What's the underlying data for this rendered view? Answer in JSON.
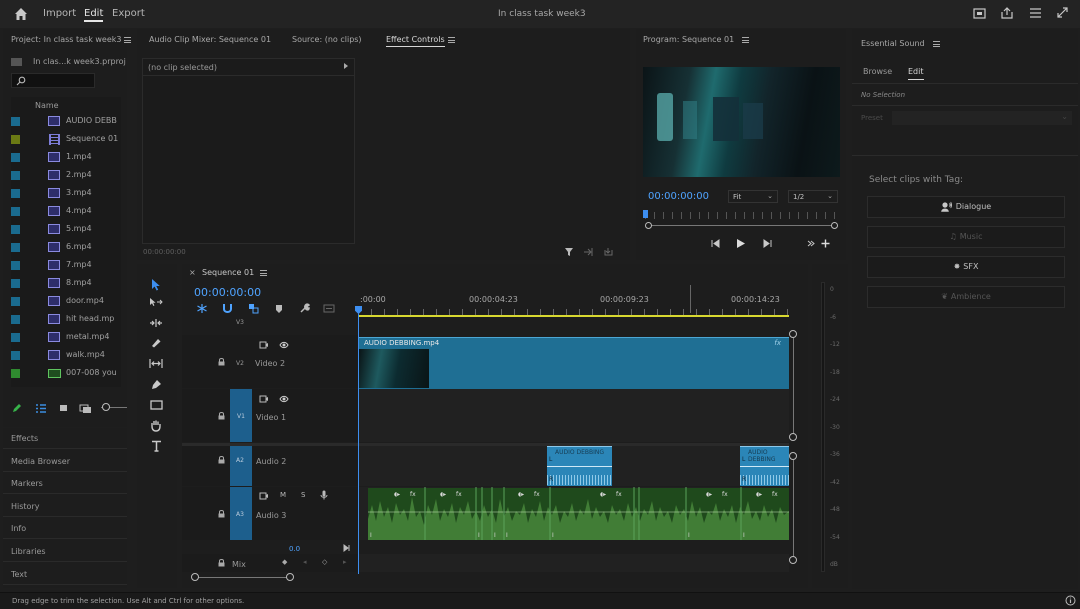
{
  "topbar": {
    "nav": [
      "Import",
      "Edit",
      "Export"
    ],
    "active": "Edit",
    "title": "In class task week3"
  },
  "project": {
    "header": "Project: In class task week3",
    "file": "In clas...k week3.prproj",
    "col_name": "Name",
    "items": [
      {
        "name": "AUDIO DEBB",
        "color": "#1a6b8f",
        "kind": "video"
      },
      {
        "name": "Sequence 01",
        "color": "#6b7a14",
        "kind": "sequence"
      },
      {
        "name": "1.mp4",
        "color": "#1a6b8f",
        "kind": "video"
      },
      {
        "name": "2.mp4",
        "color": "#1a6b8f",
        "kind": "video"
      },
      {
        "name": "3.mp4",
        "color": "#1a6b8f",
        "kind": "video"
      },
      {
        "name": "4.mp4",
        "color": "#1a6b8f",
        "kind": "video"
      },
      {
        "name": "5.mp4",
        "color": "#1a6b8f",
        "kind": "video"
      },
      {
        "name": "6.mp4",
        "color": "#1a6b8f",
        "kind": "video"
      },
      {
        "name": "7.mp4",
        "color": "#1a6b8f",
        "kind": "video"
      },
      {
        "name": "8.mp4",
        "color": "#1a6b8f",
        "kind": "video"
      },
      {
        "name": "door.mp4",
        "color": "#1a6b8f",
        "kind": "video"
      },
      {
        "name": "hit head.mp",
        "color": "#1a6b8f",
        "kind": "video"
      },
      {
        "name": "metal.mp4",
        "color": "#1a6b8f",
        "kind": "video"
      },
      {
        "name": "walk.mp4",
        "color": "#1a6b8f",
        "kind": "video"
      },
      {
        "name": "007-008 you",
        "color": "#2f8a2f",
        "kind": "audio"
      }
    ],
    "side_links": [
      "Effects",
      "Media Browser",
      "Markers",
      "History",
      "Info",
      "Libraries",
      "Text"
    ]
  },
  "source": {
    "tabs": [
      "Audio Clip Mixer: Sequence 01",
      "Source: (no clips)",
      "Effect Controls"
    ],
    "active_tab": "Effect Controls",
    "no_clip": "(no clip selected)",
    "timecode": "00:00:00:00"
  },
  "program": {
    "header": "Program: Sequence 01",
    "timecode": "00:00:00:00",
    "fit": "Fit",
    "quality": "1/2"
  },
  "essential": {
    "header": "Essential Sound",
    "tabs": [
      "Browse",
      "Edit"
    ],
    "active_tab": "Edit",
    "no_selection": "No Selection",
    "preset_label": "Preset",
    "select_tag": "Select clips with Tag:",
    "tags": [
      {
        "label": "Dialogue",
        "enabled": true
      },
      {
        "label": "Music",
        "enabled": false
      },
      {
        "label": "SFX",
        "enabled": true
      },
      {
        "label": "Ambience",
        "enabled": false
      }
    ]
  },
  "timeline": {
    "sequence_tab": "Sequence 01",
    "timecode": "00:00:00:00",
    "ruler": [
      ":00:00",
      "00:00:04:23",
      "00:00:09:23",
      "00:00:14:23"
    ],
    "tracks": {
      "v3": "V3",
      "v2": {
        "id": "V2",
        "name": "Video 2"
      },
      "v1": {
        "id": "V1",
        "name": "Video 1"
      },
      "a2": {
        "id": "A2",
        "name": "Audio 2"
      },
      "a3": {
        "id": "A3",
        "name": "Audio 3"
      },
      "mix": "Mix",
      "mix_value": "0.0"
    },
    "video_clip_label": "AUDIO DEBBING.mp4",
    "audio_clip_label": "AUDIO DEBBING"
  },
  "meter": {
    "scale": [
      "0",
      "-6",
      "-12",
      "-18",
      "-24",
      "-30",
      "-36",
      "-42",
      "-48",
      "-54",
      "dB"
    ]
  },
  "status": {
    "text": "Drag edge to trim the selection. Use Alt and Ctrl for other options."
  }
}
